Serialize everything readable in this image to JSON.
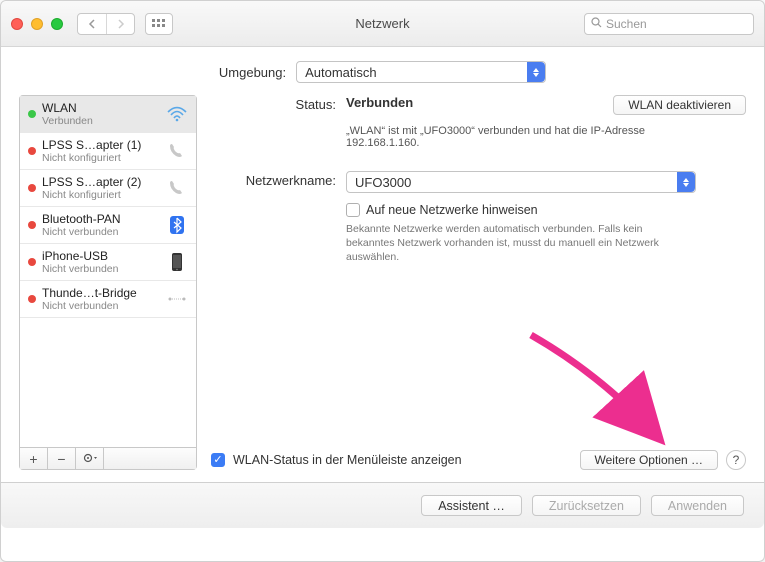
{
  "window": {
    "title": "Netzwerk"
  },
  "search": {
    "placeholder": "Suchen"
  },
  "location": {
    "label": "Umgebung:",
    "value": "Automatisch"
  },
  "sidebar": {
    "items": [
      {
        "name": "WLAN",
        "status": "Verbunden",
        "dot": "green",
        "icon": "wifi"
      },
      {
        "name": "LPSS S…apter (1)",
        "status": "Nicht konfiguriert",
        "dot": "red",
        "icon": "phone"
      },
      {
        "name": "LPSS S…apter (2)",
        "status": "Nicht konfiguriert",
        "dot": "red",
        "icon": "phone"
      },
      {
        "name": "Bluetooth-PAN",
        "status": "Nicht verbunden",
        "dot": "red",
        "icon": "bluetooth"
      },
      {
        "name": "iPhone-USB",
        "status": "Nicht verbunden",
        "dot": "red",
        "icon": "iphone"
      },
      {
        "name": "Thunde…t-Bridge",
        "status": "Nicht verbunden",
        "dot": "red",
        "icon": "thunderbolt"
      }
    ]
  },
  "panel": {
    "status_label": "Status:",
    "status_value": "Verbunden",
    "deactivate": "WLAN deaktivieren",
    "status_sub": "„WLAN“ ist mit „UFO3000“ verbunden und hat die IP-Adresse 192.168.1.160.",
    "network_label": "Netzwerkname:",
    "network_value": "UFO3000",
    "new_networks_label": "Auf neue Netzwerke hinweisen",
    "new_networks_hint": "Bekannte Netzwerke werden automatisch verbunden. Falls kein bekanntes Netzwerk vorhanden ist, musst du manuell ein Netzwerk auswählen.",
    "show_menubar": "WLAN-Status in der Menüleiste anzeigen",
    "more_options": "Weitere Optionen …",
    "help": "?"
  },
  "bottom": {
    "assistant": "Assistent …",
    "revert": "Zurücksetzen",
    "apply": "Anwenden"
  }
}
